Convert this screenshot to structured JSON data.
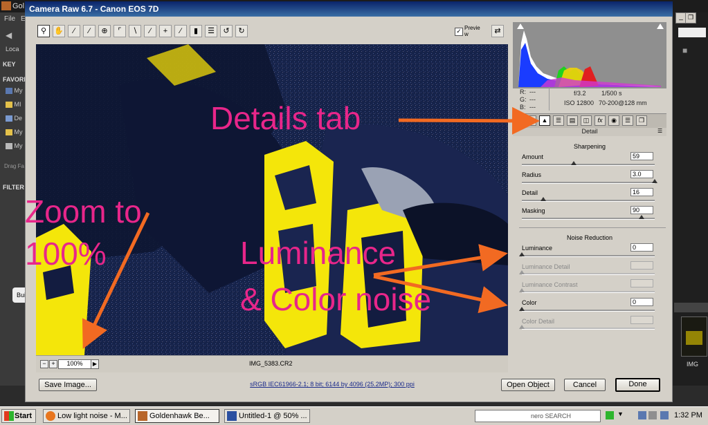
{
  "window": {
    "title": "Camera Raw 6.7  -  Canon EOS 7D"
  },
  "toolbar": {
    "preview_label": "Previe w"
  },
  "readout": {
    "r_label": "R:",
    "r_value": "---",
    "g_label": "G:",
    "g_value": "---",
    "b_label": "B:",
    "b_value": "---",
    "aperture": "f/3.2",
    "shutter": "1/500 s",
    "iso": "ISO 12800",
    "lens": "70-200@128 mm"
  },
  "panel": {
    "title": "Detail",
    "sharpening": {
      "heading": "Sharpening",
      "amount_label": "Amount",
      "amount_value": "59",
      "amount_pct": 0.39,
      "radius_label": "Radius",
      "radius_value": "3.0",
      "radius_pct": 1.0,
      "detail_label": "Detail",
      "detail_value": "16",
      "detail_pct": 0.16,
      "masking_label": "Masking",
      "masking_value": "90",
      "masking_pct": 0.9
    },
    "noise": {
      "heading": "Noise Reduction",
      "luminance_label": "Luminance",
      "luminance_value": "0",
      "lum_detail_label": "Luminance Detail",
      "lum_contrast_label": "Luminance Contrast",
      "color_label": "Color",
      "color_value": "0",
      "color_detail_label": "Color Detail"
    }
  },
  "statusbar": {
    "zoom": "100%",
    "filename": "IMG_5383.CR2"
  },
  "footer": {
    "save_label": "Save Image...",
    "info_link": "sRGB IEC61966-2.1; 8 bit; 6144 by 4096 (25.2MP); 300 ppi",
    "open_label": "Open Object",
    "cancel_label": "Cancel",
    "done_label": "Done"
  },
  "annotations": {
    "details_tab": "Details tab",
    "zoom_line1": "Zoom to",
    "zoom_line2": "100%",
    "noise_line1": "Luminance",
    "noise_line2": "& Color noise"
  },
  "taskbar": {
    "start_label": "Start",
    "task1": "Low light noise - M...",
    "task2": "Goldenhawk Be...",
    "task3": "Untitled-1 @ 50% ...",
    "search_label": "nero SEARCH",
    "clock": "1:32 PM"
  },
  "bridge": {
    "app_label": "Gol",
    "menu_file": "File",
    "menu_edit": "E",
    "loc_label": "Loca",
    "key_label": "KEY",
    "fav_label": "FAVORI",
    "fav_items": [
      "My",
      "MI",
      "De",
      "My",
      "My"
    ],
    "drag_label": "Drag Fa",
    "filter_label": "FILTER",
    "build_label": "Buil",
    "thumb_label": "IMG"
  },
  "colors": {
    "annotation": "#e8268a",
    "arrow": "#f26a22",
    "jersey_yellow": "#f4e60a"
  }
}
